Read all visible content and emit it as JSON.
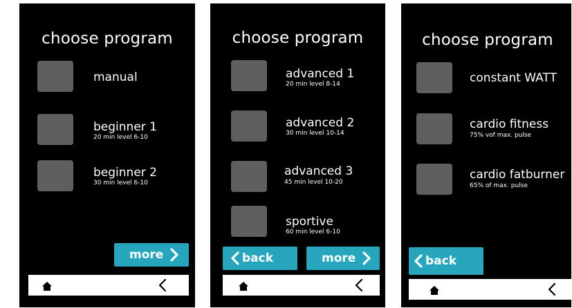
{
  "colors": {
    "screen_bg": "#000000",
    "tile": "#5f5f5f",
    "button": "#27a5bd",
    "nav_bg": "#ffffff",
    "text": "#ffffff"
  },
  "icons": {
    "home": "home-icon",
    "back_nav": "chevron-left-icon",
    "more": "chevron-right-icon",
    "back_button": "chevron-left-icon"
  },
  "screens": [
    {
      "title": "choose program",
      "programs": [
        {
          "name": "manual",
          "detail": ""
        },
        {
          "name": "beginner 1",
          "detail": "20 min  level 6-10"
        },
        {
          "name": "beginner 2",
          "detail": "30 min level 6-10"
        }
      ],
      "more_label": "more"
    },
    {
      "title": "choose program",
      "programs": [
        {
          "name": "advanced 1",
          "detail": "20 min  level 8-14"
        },
        {
          "name": "advanced 2",
          "detail": "30 min level 10-14"
        },
        {
          "name": "advanced 3",
          "detail": "45 min level 10-20"
        },
        {
          "name": "sportive",
          "detail": "60 min level 6-10"
        }
      ],
      "back_label": "back",
      "more_label": "more"
    },
    {
      "title": "choose program",
      "programs": [
        {
          "name": "constant WATT",
          "detail": ""
        },
        {
          "name": "cardio fitness",
          "detail": "75% vof max. pulse"
        },
        {
          "name": "cardio fatburner",
          "detail": "65% of max. pulse"
        }
      ],
      "back_label": "back"
    }
  ]
}
